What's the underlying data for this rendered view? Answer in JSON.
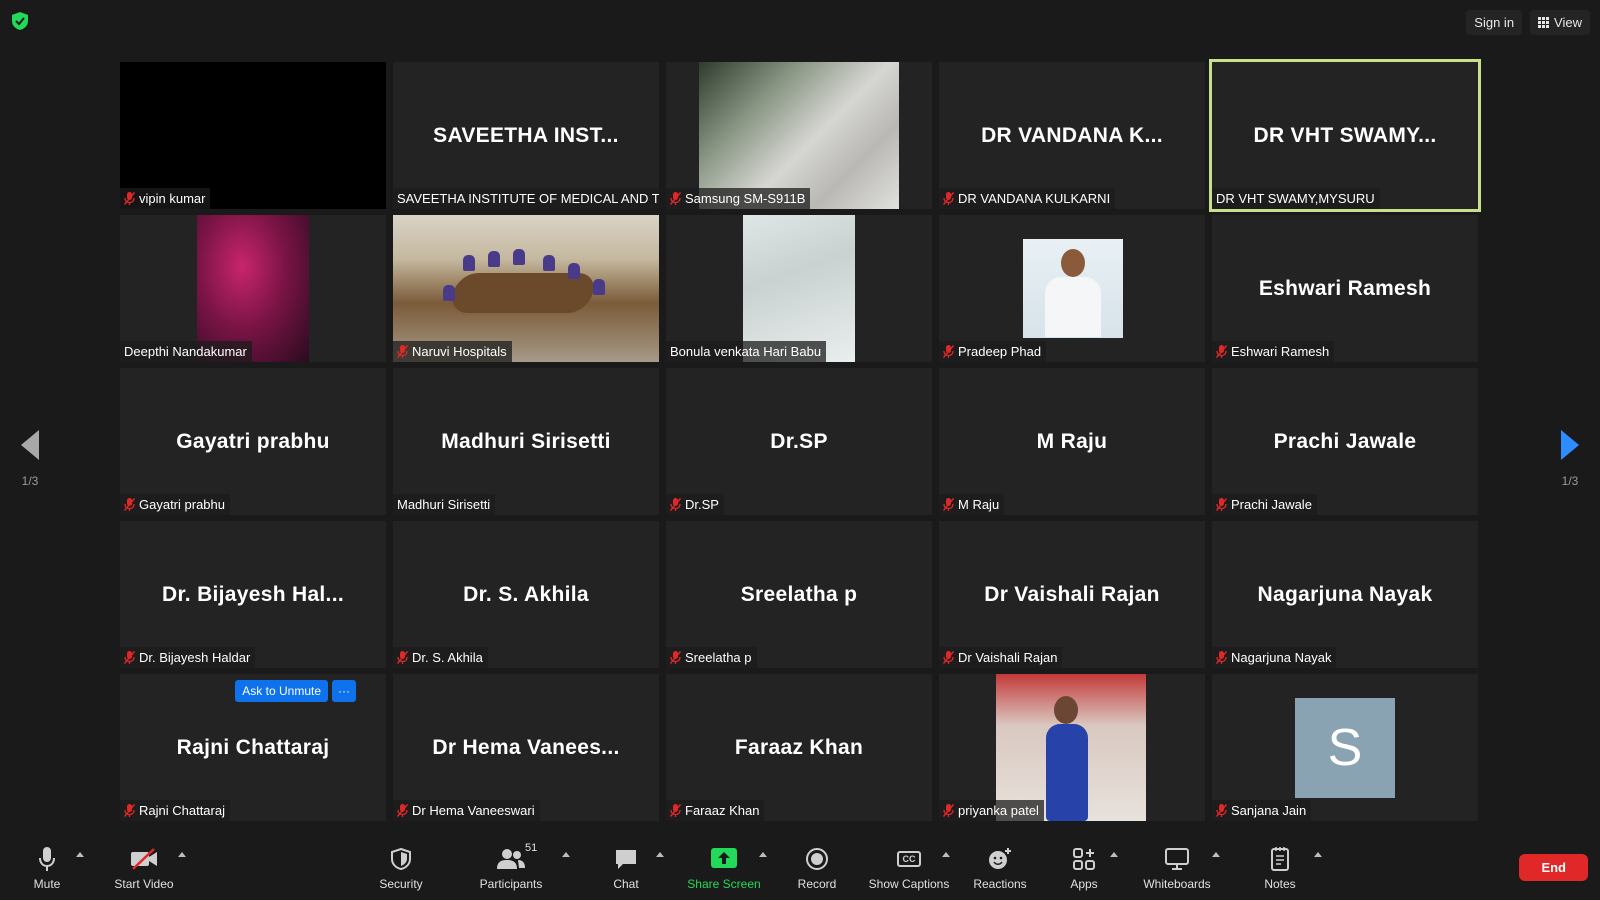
{
  "top_bar": {
    "sign_in_label": "Sign in",
    "view_label": "View",
    "security_icon": "shield-check-icon",
    "accent_green": "#23d959"
  },
  "pager": {
    "left_page": "1/3",
    "right_page": "1/3"
  },
  "tiles": [
    {
      "display_name": "",
      "label": "vipin kumar",
      "muted": true,
      "video": "black"
    },
    {
      "display_name": "SAVEETHA  INST...",
      "label": "SAVEETHA INSTITUTE OF MEDICAL AND TE...",
      "muted": false,
      "video": "none"
    },
    {
      "display_name": "",
      "label": "Samsung SM-S911B",
      "muted": true,
      "video": "samsung"
    },
    {
      "display_name": "DR VANDANA K...",
      "label": "DR VANDANA KULKARNI",
      "muted": true,
      "video": "none"
    },
    {
      "display_name": "DR VHT SWAMY...",
      "label": "DR VHT SWAMY,MYSURU",
      "muted": false,
      "video": "none",
      "active_speaker": true
    },
    {
      "display_name": "",
      "label": "Deepthi Nandakumar",
      "muted": false,
      "video": "deepthi"
    },
    {
      "display_name": "",
      "label": "Naruvi Hospitals",
      "muted": true,
      "video": "naruvi"
    },
    {
      "display_name": "",
      "label": "Bonula venkata Hari Babu",
      "muted": false,
      "video": "bonula"
    },
    {
      "display_name": "",
      "label": "Pradeep Phad",
      "muted": true,
      "video": "pradeep"
    },
    {
      "display_name": "Eshwari Ramesh",
      "label": "Eshwari Ramesh",
      "muted": true,
      "video": "none"
    },
    {
      "display_name": "Gayatri prabhu",
      "label": "Gayatri prabhu",
      "muted": true,
      "video": "none"
    },
    {
      "display_name": "Madhuri Sirisetti",
      "label": "Madhuri Sirisetti",
      "muted": false,
      "video": "none"
    },
    {
      "display_name": "Dr.SP",
      "label": "Dr.SP",
      "muted": true,
      "video": "none"
    },
    {
      "display_name": "M Raju",
      "label": "M Raju",
      "muted": true,
      "video": "none"
    },
    {
      "display_name": "Prachi Jawale",
      "label": "Prachi Jawale",
      "muted": true,
      "video": "none"
    },
    {
      "display_name": "Dr. Bijayesh  Hal...",
      "label": "Dr. Bijayesh Haldar",
      "muted": true,
      "video": "none"
    },
    {
      "display_name": "Dr. S. Akhila",
      "label": "Dr. S. Akhila",
      "muted": true,
      "video": "none"
    },
    {
      "display_name": "Sreelatha  p",
      "label": "Sreelatha  p",
      "muted": true,
      "video": "none"
    },
    {
      "display_name": "Dr Vaishali Rajan",
      "label": "Dr Vaishali Rajan",
      "muted": true,
      "video": "none"
    },
    {
      "display_name": "Nagarjuna Nayak",
      "label": "Nagarjuna Nayak",
      "muted": true,
      "video": "none"
    },
    {
      "display_name": "Rajni Chattaraj",
      "label": "Rajni Chattaraj",
      "muted": true,
      "video": "none",
      "ask_to_unmute": true
    },
    {
      "display_name": "Dr  Hema Vanees...",
      "label": "Dr Hema Vaneeswari",
      "muted": true,
      "video": "none"
    },
    {
      "display_name": "Faraaz Khan",
      "label": "Faraaz Khan",
      "muted": true,
      "video": "none"
    },
    {
      "display_name": "",
      "label": "priyanka patel",
      "muted": true,
      "video": "priyanka"
    },
    {
      "display_name": "",
      "label": "Sanjana Jain",
      "muted": true,
      "video": "avatar",
      "avatar_letter": "S"
    }
  ],
  "ask_to_unmute": {
    "button_label": "Ask to Unmute",
    "more_label": "···"
  },
  "toolbar": {
    "mute_label": "Mute",
    "start_video_label": "Start Video",
    "security_label": "Security",
    "participants_label": "Participants",
    "participants_count": "51",
    "chat_label": "Chat",
    "share_screen_label": "Share Screen",
    "record_label": "Record",
    "captions_label": "Show Captions",
    "captions_icon_text": "CC",
    "reactions_label": "Reactions",
    "apps_label": "Apps",
    "whiteboards_label": "Whiteboards",
    "notes_label": "Notes",
    "end_label": "End",
    "end_color": "#e02828"
  }
}
